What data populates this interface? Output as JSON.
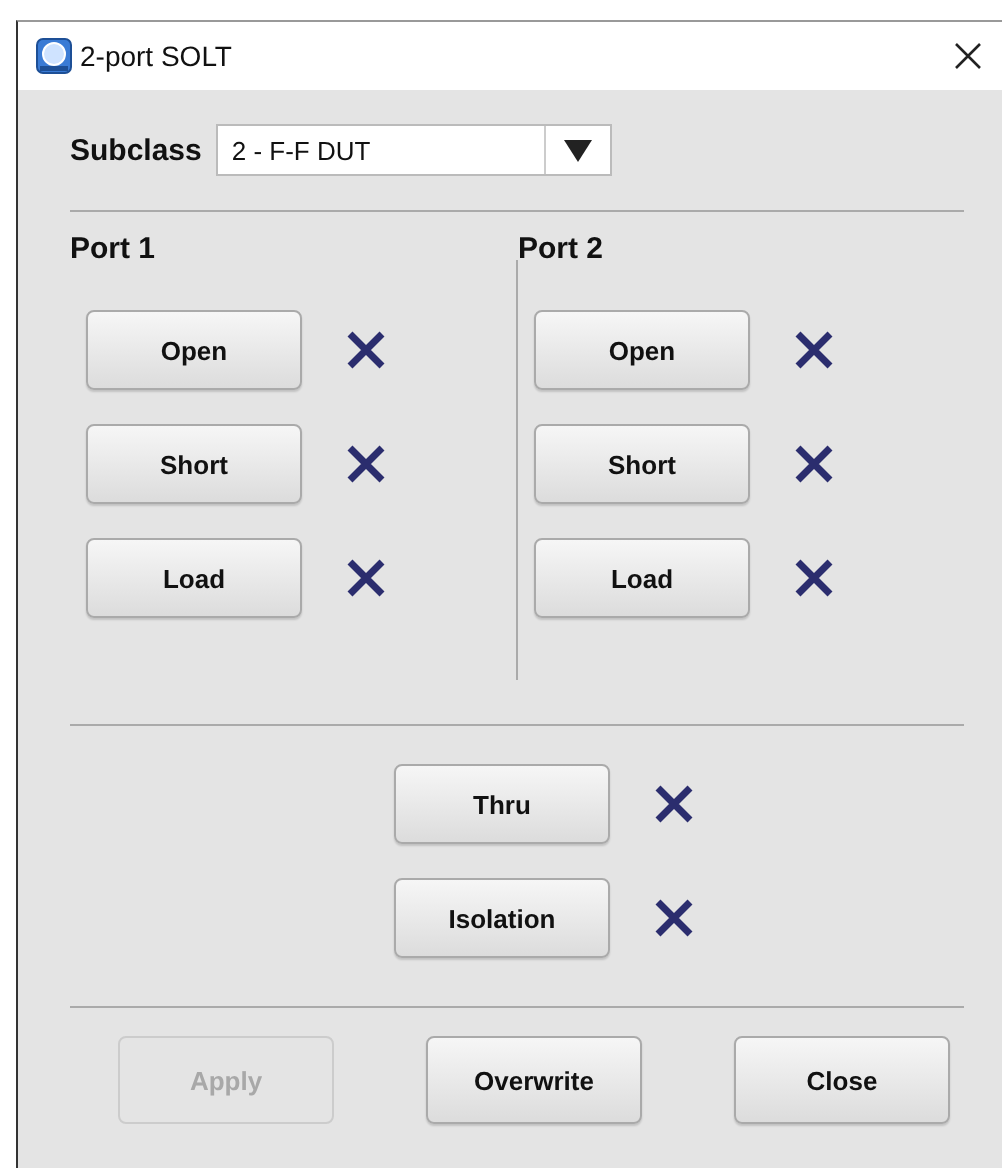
{
  "window": {
    "title": "2-port SOLT"
  },
  "subclass": {
    "label": "Subclass",
    "value": "2 - F-F DUT"
  },
  "ports": [
    {
      "label": "Port 1",
      "standards": [
        {
          "label": "Open",
          "done": false
        },
        {
          "label": "Short",
          "done": false
        },
        {
          "label": "Load",
          "done": false
        }
      ]
    },
    {
      "label": "Port 2",
      "standards": [
        {
          "label": "Open",
          "done": false
        },
        {
          "label": "Short",
          "done": false
        },
        {
          "label": "Load",
          "done": false
        }
      ]
    }
  ],
  "shared": [
    {
      "label": "Thru",
      "done": false
    },
    {
      "label": "Isolation",
      "done": false
    }
  ],
  "buttons": [
    {
      "label": "Apply",
      "disabled": true
    },
    {
      "label": "Overwrite",
      "disabled": false
    },
    {
      "label": "Close",
      "disabled": false
    }
  ]
}
